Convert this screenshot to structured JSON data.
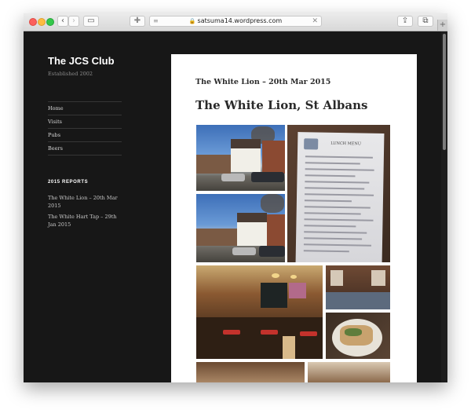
{
  "browser": {
    "url": "satsuma14.wordpress.com",
    "back_icon": "‹",
    "forward_icon": "›",
    "sidebar_icon": "▭",
    "extension_icon": "✚",
    "reader_icon": "≡",
    "lock_icon": "🔒",
    "reload_icon": "✕",
    "share_icon": "⇪",
    "tabs_icon": "⧉",
    "newtab_icon": "+"
  },
  "site": {
    "title": "The JCS Club",
    "description": "Established 2002",
    "nav": [
      "Home",
      "Visits",
      "Pubs",
      "Beers"
    ],
    "widget_title": "2015 Reports",
    "widget_links": [
      "The White Lion – 20th Mar 2015",
      "The White Hart Tap – 29th Jan 2015"
    ]
  },
  "post": {
    "meta_title": "The White Lion – 20th Mar 2015",
    "heading": "The White Lion, St Albans",
    "menu_card_heading": "LUNCH MENU"
  },
  "colors": {
    "sidebar_bg": "#171717",
    "content_bg": "#ffffff",
    "text_dark": "#2a2a2a"
  }
}
